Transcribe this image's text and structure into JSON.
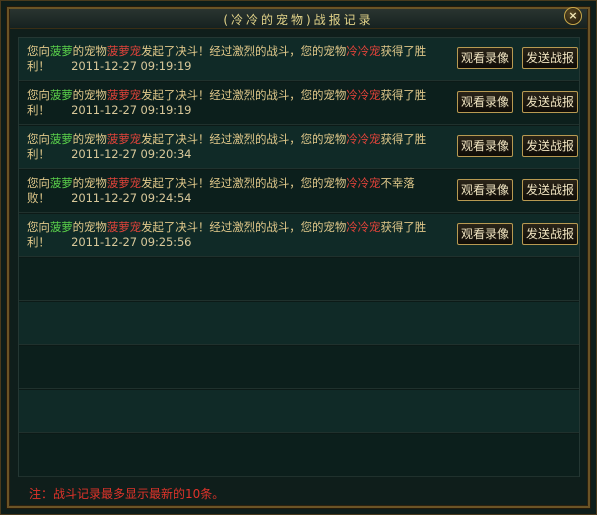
{
  "window": {
    "title": "(冷冷的宠物)战报记录",
    "close_label": "×"
  },
  "records": [
    {
      "prefix": "您向",
      "target": "菠萝",
      "mid1": "的宠物",
      "target_pet": "菠萝宠",
      "mid2": "发起了决斗！经过激烈的战斗，您的宠物",
      "my_pet": "冷冷宠",
      "result": "获得了胜利！",
      "time": "2011-12-27 09:19:19",
      "watch_label": "观看录像",
      "send_label": "发送战报"
    },
    {
      "prefix": "您向",
      "target": "菠萝",
      "mid1": "的宠物",
      "target_pet": "菠萝宠",
      "mid2": "发起了决斗！经过激烈的战斗，您的宠物",
      "my_pet": "冷冷宠",
      "result": "获得了胜利！",
      "time": "2011-12-27 09:19:19",
      "watch_label": "观看录像",
      "send_label": "发送战报"
    },
    {
      "prefix": "您向",
      "target": "菠萝",
      "mid1": "的宠物",
      "target_pet": "菠萝宠",
      "mid2": "发起了决斗！经过激烈的战斗，您的宠物",
      "my_pet": "冷冷宠",
      "result": "获得了胜利！",
      "time": "2011-12-27 09:20:34",
      "watch_label": "观看录像",
      "send_label": "发送战报"
    },
    {
      "prefix": "您向",
      "target": "菠萝",
      "mid1": "的宠物",
      "target_pet": "菠萝宠",
      "mid2": "发起了决斗！经过激烈的战斗，您的宠物",
      "my_pet": "冷冷宠",
      "result": "不幸落败！",
      "time": "2011-12-27 09:24:54",
      "watch_label": "观看录像",
      "send_label": "发送战报"
    },
    {
      "prefix": "您向",
      "target": "菠萝",
      "mid1": "的宠物",
      "target_pet": "菠萝宠",
      "mid2": "发起了决斗！经过激烈的战斗，您的宠物",
      "my_pet": "冷冷宠",
      "result": "获得了胜利！",
      "time": "2011-12-27 09:25:56",
      "watch_label": "观看录像",
      "send_label": "发送战报"
    }
  ],
  "empty_rows": 5,
  "footer": {
    "note": "注：战斗记录最多显示最新的10条。"
  },
  "colors": {
    "player_name": "#5ad04a",
    "pet_name": "#e0433a",
    "body_text": "#e0c88a",
    "note": "#e0332a",
    "title": "#e3d48a"
  }
}
